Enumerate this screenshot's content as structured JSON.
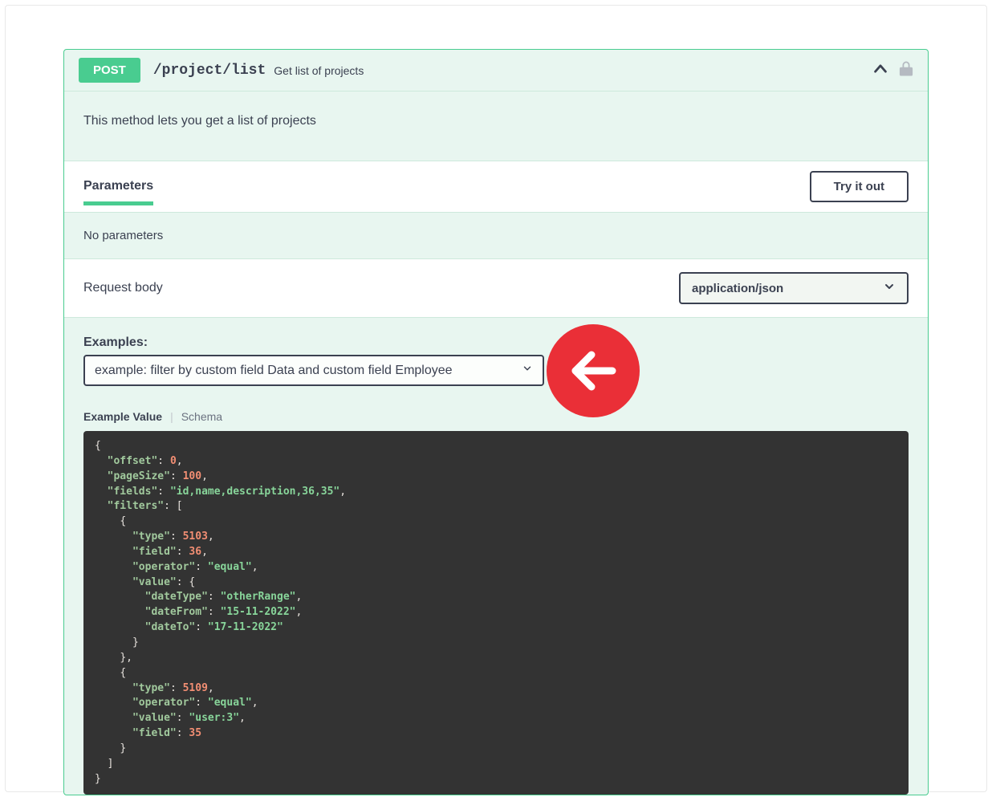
{
  "method": "POST",
  "path": "/project/list",
  "summary": "Get list of projects",
  "description": "This method lets you get a list of projects",
  "tabs": {
    "parameters": "Parameters",
    "try_it_out": "Try it out"
  },
  "no_parameters": "No parameters",
  "request_body_label": "Request body",
  "content_type": "application/json",
  "examples_label": "Examples:",
  "example_selected": "example: filter by custom field Data and custom field Employee",
  "example_value_label": "Example Value",
  "schema_label": "Schema",
  "example_json": {
    "offset": 0,
    "pageSize": 100,
    "fields": "id,name,description,36,35",
    "filters": [
      {
        "type": 5103,
        "field": 36,
        "operator": "equal",
        "value": {
          "dateType": "otherRange",
          "dateFrom": "15-11-2022",
          "dateTo": "17-11-2022"
        }
      },
      {
        "type": 5109,
        "operator": "equal",
        "value": "user:3",
        "field": 35
      }
    ]
  }
}
